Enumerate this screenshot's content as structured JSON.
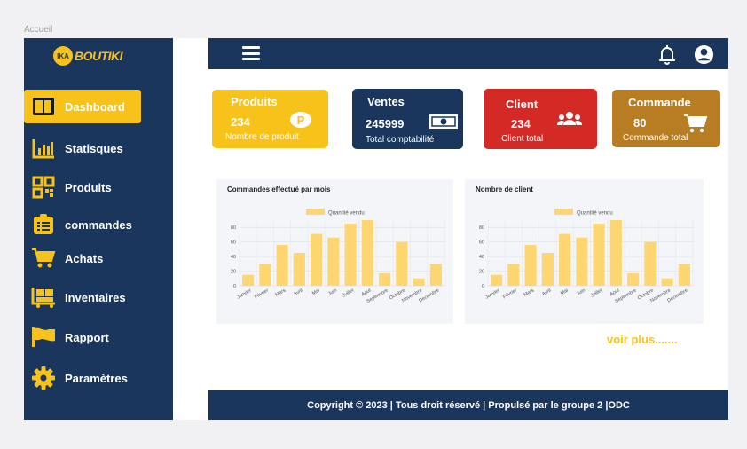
{
  "frame_label": "Accueil",
  "logo": {
    "badge": "IKA",
    "text": "BOUTIKI"
  },
  "sidebar": {
    "items": [
      {
        "label": "Dashboard",
        "icon": "dashboard-icon",
        "active": true
      },
      {
        "label": "Statisques",
        "icon": "bar-chart-icon"
      },
      {
        "label": "Produits",
        "icon": "qr-code-icon"
      },
      {
        "label": "commandes",
        "icon": "clipboard-icon"
      },
      {
        "label": "Achats",
        "icon": "cart-icon"
      },
      {
        "label": "Inventaires",
        "icon": "inventory-icon"
      },
      {
        "label": "Rapport",
        "icon": "flag-icon"
      },
      {
        "label": "Paramètres",
        "icon": "gear-icon"
      }
    ]
  },
  "topbar": {
    "menu_icon": "hamburger-icon",
    "bell_icon": "bell-icon",
    "user_icon": "user-avatar-icon"
  },
  "cards": [
    {
      "title": "Produits",
      "value": "234",
      "subtitle": "Nombre de produit",
      "color": "#f7c21a",
      "icon": "coin-icon"
    },
    {
      "title": "Ventes",
      "value": "245999",
      "subtitle": "Total comptabilité",
      "color": "#1b365d",
      "icon": "banknote-icon"
    },
    {
      "title": "Client",
      "value": "234",
      "subtitle": "Client total",
      "color": "#d32a26",
      "icon": "users-icon"
    },
    {
      "title": "Commande",
      "value": "80",
      "subtitle": "Commande total",
      "color": "#b87c22",
      "icon": "cart-icon"
    }
  ],
  "chart_data": [
    {
      "type": "bar",
      "title": "Commandes effectué par mois",
      "legend": "Quantité vendu",
      "legend_position": "top",
      "categories": [
        "Janvier",
        "Février",
        "Mars",
        "Avril",
        "Mai",
        "Juin",
        "Juillet",
        "Aout",
        "Septembre",
        "Octobre",
        "Novembre",
        "Decembre"
      ],
      "values": [
        15,
        30,
        56,
        45,
        71,
        66,
        85,
        90,
        17,
        60,
        10,
        30
      ],
      "ylim": [
        0,
        90
      ],
      "yticks": [
        0,
        20,
        40,
        60,
        80
      ],
      "grid": true,
      "color": "#fdd672"
    },
    {
      "type": "bar",
      "title": "Nombre de client",
      "legend": "Quantité vendu",
      "legend_position": "top",
      "categories": [
        "Janvier",
        "Février",
        "Mars",
        "Avril",
        "Mai",
        "Juin",
        "Juillet",
        "Aout",
        "Septembre",
        "Octobre",
        "Novembre",
        "Decembre"
      ],
      "values": [
        15,
        30,
        56,
        45,
        71,
        66,
        85,
        90,
        17,
        60,
        10,
        30
      ],
      "ylim": [
        0,
        90
      ],
      "yticks": [
        0,
        20,
        40,
        60,
        80
      ],
      "grid": true,
      "color": "#fdd672"
    }
  ],
  "voir_plus": "voir plus.......",
  "footer": "Copyright © 2023 | Tous droit réservé | Propulsé par le groupe 2 |ODC"
}
